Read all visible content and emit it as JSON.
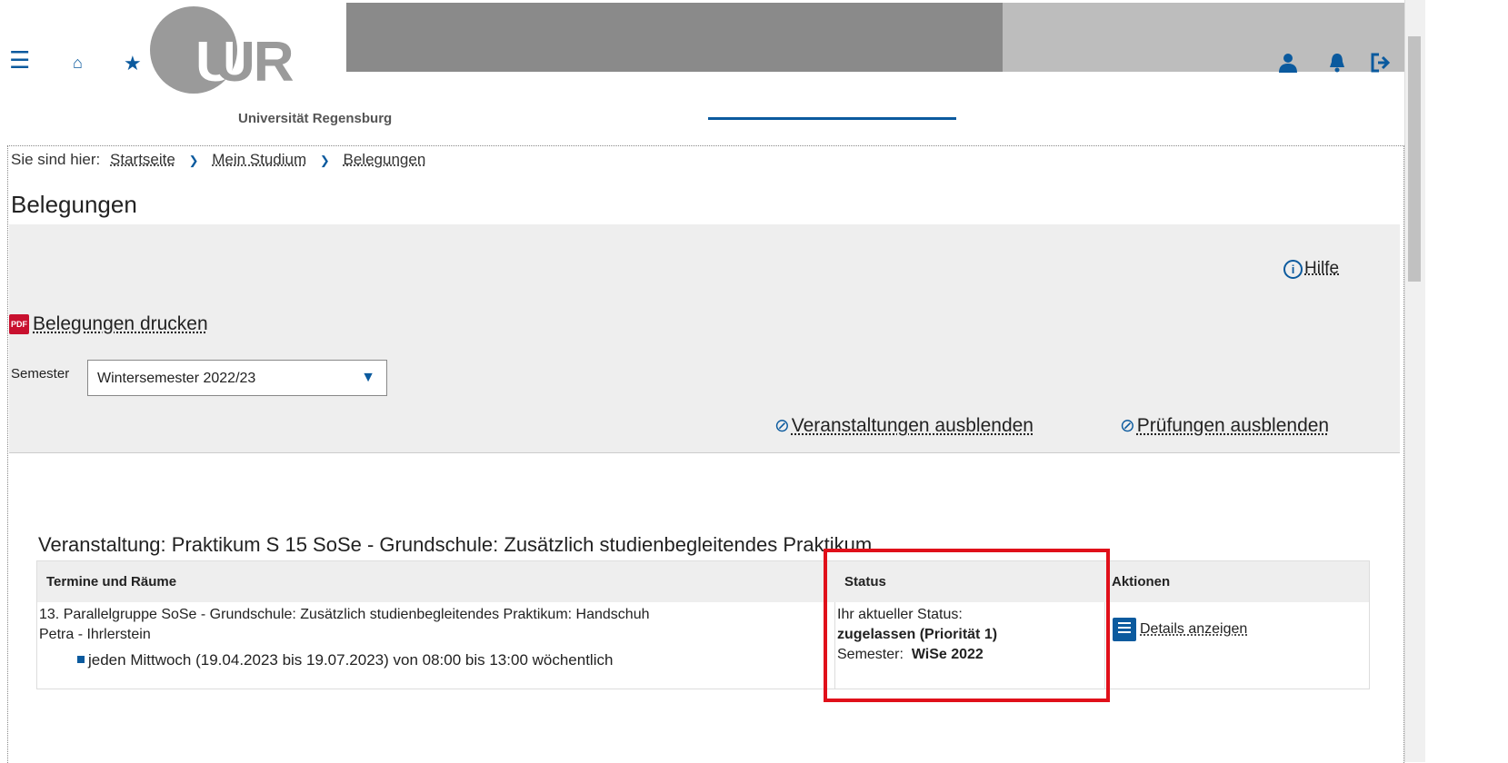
{
  "header": {
    "logo_text": "UR",
    "university_name": "Universität Regensburg",
    "icons": [
      "menu-icon",
      "home-icon",
      "star-icon",
      "user-icon",
      "bell-icon",
      "logout-icon"
    ]
  },
  "breadcrumb": {
    "prefix": "Sie sind hier:",
    "items": [
      "Startseite",
      "Mein Studium",
      "Belegungen"
    ]
  },
  "page_title": "Belegungen",
  "help_label": "Hilfe",
  "print_label": "Belegungen drucken",
  "semester": {
    "label": "Semester",
    "selected": "Wintersemester 2022/23"
  },
  "hide_events_label": "Veranstaltungen ausblenden",
  "hide_exams_label": "Prüfungen ausblenden",
  "course": {
    "title": "Veranstaltung: Praktikum S 15 SoSe - Grundschule: Zusätzlich studienbegleitendes Praktikum",
    "columns": [
      "Termine und Räume",
      "Status",
      "Aktionen"
    ],
    "group_text": "13. Parallelgruppe SoSe - Grundschule: Zusätzlich studienbegleitendes Praktikum: Handschuh",
    "group_text_2": "Petra - Ihrlerstein",
    "schedule": "jeden Mittwoch (19.04.2023 bis 19.07.2023) von 08:00 bis 13:00 wöchentlich",
    "status_line1": "Ihr aktueller Status:",
    "status_line2": "zugelassen (Priorität 1)",
    "semester_label": "Semester:",
    "semester_value": "WiSe 2022",
    "action_label": "Details anzeigen"
  },
  "colors": {
    "accent": "#0b5a9e",
    "highlight_box": "#e0101a"
  }
}
